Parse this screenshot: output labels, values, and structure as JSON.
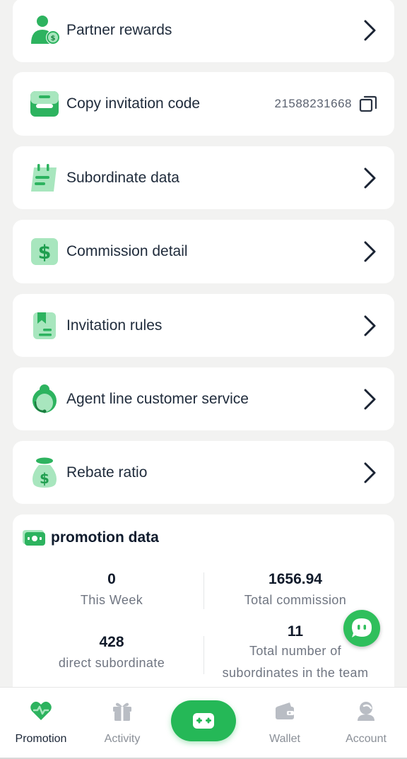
{
  "menu": {
    "partner_rewards": "Partner rewards",
    "copy_invitation_code": "Copy invitation code",
    "invitation_code_value": "21588231668",
    "subordinate_data": "Subordinate data",
    "commission_detail": "Commission detail",
    "invitation_rules": "Invitation rules",
    "agent_customer_service": "Agent line customer service",
    "rebate_ratio": "Rebate ratio"
  },
  "promotion_data": {
    "title": "promotion data",
    "this_week_value": "0",
    "this_week_label": "This Week",
    "total_commission_value": "1656.94",
    "total_commission_label": "Total commission",
    "direct_subordinate_value": "428",
    "direct_subordinate_label": "direct subordinate",
    "team_subordinates_value": "11",
    "team_subordinates_label": "Total number of subordinates in the team"
  },
  "nav": {
    "promotion": "Promotion",
    "activity": "Activity",
    "wallet": "Wallet",
    "account": "Account"
  },
  "icons": {
    "partner_rewards": "user-coin-icon",
    "copy_invitation_code": "inbox-icon",
    "subordinate_data": "calendar-notes-icon",
    "commission_detail": "dollar-icon",
    "invitation_rules": "bookmark-doc-icon",
    "agent_customer_service": "headset-agent-icon",
    "rebate_ratio": "money-bag-icon"
  },
  "colors": {
    "accent": "#25b857",
    "icon_light": "#a8e6be",
    "icon_dark": "#2db35f"
  }
}
